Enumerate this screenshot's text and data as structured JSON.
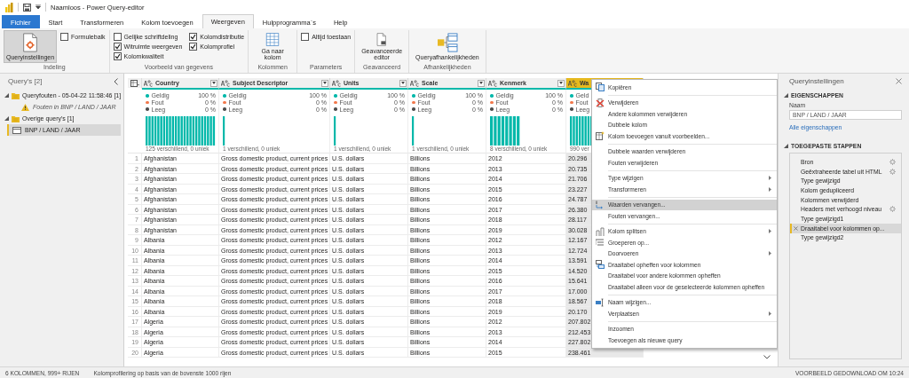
{
  "window": {
    "title": "Naamloos - Power Query-editor"
  },
  "ribbon_tabs": [
    {
      "label": "Fichier",
      "kind": "file",
      "selected": false
    },
    {
      "label": "Start",
      "kind": "tab",
      "selected": false
    },
    {
      "label": "Transformeren",
      "kind": "tab",
      "selected": false
    },
    {
      "label": "Kolom toevoegen",
      "kind": "tab",
      "selected": false
    },
    {
      "label": "Weergeven",
      "kind": "tab",
      "selected": true
    },
    {
      "label": "Hulpprogramma`s",
      "kind": "tab",
      "selected": false
    },
    {
      "label": "Help",
      "kind": "tab",
      "selected": false
    }
  ],
  "ribbon_groups": [
    {
      "label": "Indeling",
      "controls": [
        {
          "kind": "large",
          "label": "Queryinstellingen",
          "selected": true
        },
        {
          "kind": "checkbox",
          "label": "Formulebalk",
          "checked": false
        }
      ]
    },
    {
      "label": "Voorbeeld van gegevens",
      "controls": [
        {
          "kind": "checkbox",
          "label": "Gelijke schriftdeling",
          "checked": false
        },
        {
          "kind": "checkbox",
          "label": "Witruimte weergeven",
          "checked": true
        },
        {
          "kind": "checkbox",
          "label": "Kolomkwaliteit",
          "checked": true
        },
        {
          "kind": "checkbox",
          "label": "Kolomdistributie",
          "checked": true
        },
        {
          "kind": "checkbox",
          "label": "Kolomprofiel",
          "checked": true
        }
      ]
    },
    {
      "label": "Kolommen",
      "controls": [
        {
          "kind": "large",
          "label": "Ga naar kolom",
          "selected": false
        }
      ]
    },
    {
      "label": "Parameters",
      "controls": [
        {
          "kind": "checkbox",
          "label": "Altijd toestaan",
          "checked": false
        }
      ]
    },
    {
      "label": "Geavanceerd",
      "controls": [
        {
          "kind": "large",
          "label": "Geavanceerde editor",
          "selected": false
        }
      ]
    },
    {
      "label": "Afhankelijkheden",
      "controls": [
        {
          "kind": "large",
          "label": "Queryafhankelijkheden",
          "selected": false
        }
      ]
    }
  ],
  "query_pane": {
    "title": "Query's [2]",
    "groups": [
      {
        "label": "Queryfouten - 05-04-22 11:58:46 [1]",
        "expanded": true,
        "children": [
          {
            "label": "Fouten in BNP / LAND / JAAR",
            "kind": "error",
            "selected": false
          }
        ]
      },
      {
        "label": "Overige query's [1]",
        "expanded": true,
        "children": [
          {
            "label": "BNP / LAND / JAAR",
            "kind": "table",
            "selected": true
          }
        ]
      }
    ]
  },
  "grid": {
    "columns": [
      {
        "name": "Country",
        "selected": false,
        "kind": "many",
        "distinct": "125 verschillend, 0 uniek",
        "legend": [
          {
            "label": "Geldig",
            "value": "100 %",
            "color": "#01b8aa"
          },
          {
            "label": "Fout",
            "value": "0 %",
            "color": "#f2784b"
          },
          {
            "label": "Leeg",
            "value": "0 %",
            "color": "#4d4d4d"
          }
        ]
      },
      {
        "name": "Subject Descriptor",
        "selected": false,
        "kind": "single",
        "distinct": "1 verschillend, 0 uniek",
        "legend": [
          {
            "label": "Geldig",
            "value": "100 %",
            "color": "#01b8aa"
          },
          {
            "label": "Fout",
            "value": "0 %",
            "color": "#f2784b"
          },
          {
            "label": "Leeg",
            "value": "0 %",
            "color": "#4d4d4d"
          }
        ]
      },
      {
        "name": "Units",
        "selected": false,
        "kind": "single",
        "distinct": "1 verschillend, 0 uniek",
        "legend": [
          {
            "label": "Geldig",
            "value": "100 %",
            "color": "#01b8aa"
          },
          {
            "label": "Fout",
            "value": "0 %",
            "color": "#f2784b"
          },
          {
            "label": "Leeg",
            "value": "0 %",
            "color": "#4d4d4d"
          }
        ]
      },
      {
        "name": "Scale",
        "selected": false,
        "kind": "single",
        "distinct": "1 verschillend, 0 uniek",
        "legend": [
          {
            "label": "Geldig",
            "value": "100 %",
            "color": "#01b8aa"
          },
          {
            "label": "Fout",
            "value": "0 %",
            "color": "#f2784b"
          },
          {
            "label": "Leeg",
            "value": "0 %",
            "color": "#4d4d4d"
          }
        ]
      },
      {
        "name": "Kenmerk",
        "selected": false,
        "kind": "few",
        "distinct": "8 verschillend, 0 uniek",
        "legend": [
          {
            "label": "Geldig",
            "value": "100 %",
            "color": "#01b8aa"
          },
          {
            "label": "Fout",
            "value": "0 %",
            "color": "#f2784b"
          },
          {
            "label": "Leeg",
            "value": "0 %",
            "color": "#4d4d4d"
          }
        ]
      },
      {
        "name": "Wa",
        "selected": true,
        "kind": "many",
        "distinct": "990 ver",
        "legend": [
          {
            "label": "Geld",
            "color": "#01b8aa"
          },
          {
            "label": "Fout",
            "color": "#f2784b"
          },
          {
            "label": "Leeg",
            "color": "#4d4d4d"
          }
        ]
      }
    ],
    "rows": [
      {
        "number": "1",
        "cells": [
          "Afghanistan",
          "Gross domestic product, current prices",
          "U.S. dollars",
          "Billions",
          "2012",
          "20.296"
        ]
      },
      {
        "number": "2",
        "cells": [
          "Afghanistan",
          "Gross domestic product, current prices",
          "U.S. dollars",
          "Billions",
          "2013",
          "20.735"
        ]
      },
      {
        "number": "3",
        "cells": [
          "Afghanistan",
          "Gross domestic product, current prices",
          "U.S. dollars",
          "Billions",
          "2014",
          "21.706"
        ]
      },
      {
        "number": "4",
        "cells": [
          "Afghanistan",
          "Gross domestic product, current prices",
          "U.S. dollars",
          "Billions",
          "2015",
          "23.227"
        ]
      },
      {
        "number": "5",
        "cells": [
          "Afghanistan",
          "Gross domestic product, current prices",
          "U.S. dollars",
          "Billions",
          "2016",
          "24.787"
        ]
      },
      {
        "number": "6",
        "cells": [
          "Afghanistan",
          "Gross domestic product, current prices",
          "U.S. dollars",
          "Billions",
          "2017",
          "26.380"
        ]
      },
      {
        "number": "7",
        "cells": [
          "Afghanistan",
          "Gross domestic product, current prices",
          "U.S. dollars",
          "Billions",
          "2018",
          "28.117"
        ]
      },
      {
        "number": "8",
        "cells": [
          "Afghanistan",
          "Gross domestic product, current prices",
          "U.S. dollars",
          "Billions",
          "2019",
          "30.028"
        ]
      },
      {
        "number": "9",
        "cells": [
          "Albania",
          "Gross domestic product, current prices",
          "U.S. dollars",
          "Billions",
          "2012",
          "12.167"
        ]
      },
      {
        "number": "10",
        "cells": [
          "Albania",
          "Gross domestic product, current prices",
          "U.S. dollars",
          "Billions",
          "2013",
          "12.724"
        ]
      },
      {
        "number": "11",
        "cells": [
          "Albania",
          "Gross domestic product, current prices",
          "U.S. dollars",
          "Billions",
          "2014",
          "13.591"
        ]
      },
      {
        "number": "12",
        "cells": [
          "Albania",
          "Gross domestic product, current prices",
          "U.S. dollars",
          "Billions",
          "2015",
          "14.520"
        ]
      },
      {
        "number": "13",
        "cells": [
          "Albania",
          "Gross domestic product, current prices",
          "U.S. dollars",
          "Billions",
          "2016",
          "15.641"
        ]
      },
      {
        "number": "14",
        "cells": [
          "Albania",
          "Gross domestic product, current prices",
          "U.S. dollars",
          "Billions",
          "2017",
          "17.000"
        ]
      },
      {
        "number": "15",
        "cells": [
          "Albania",
          "Gross domestic product, current prices",
          "U.S. dollars",
          "Billions",
          "2018",
          "18.567"
        ]
      },
      {
        "number": "16",
        "cells": [
          "Albania",
          "Gross domestic product, current prices",
          "U.S. dollars",
          "Billions",
          "2019",
          "20.170"
        ]
      },
      {
        "number": "17",
        "cells": [
          "Algeria",
          "Gross domestic product, current prices",
          "U.S. dollars",
          "Billions",
          "2012",
          "207.802"
        ]
      },
      {
        "number": "18",
        "cells": [
          "Algeria",
          "Gross domestic product, current prices",
          "U.S. dollars",
          "Billions",
          "2013",
          "212.453"
        ]
      },
      {
        "number": "19",
        "cells": [
          "Algeria",
          "Gross domestic product, current prices",
          "U.S. dollars",
          "Billions",
          "2014",
          "227.802"
        ]
      },
      {
        "number": "20",
        "cells": [
          "Algeria",
          "Gross domestic product, current prices",
          "U.S. dollars",
          "Billions",
          "2015",
          "238.461"
        ]
      }
    ]
  },
  "context_menu": {
    "items": [
      {
        "kind": "copy",
        "label": "Kopiëren",
        "submenu": false,
        "selected": false
      },
      {
        "kind": "separator"
      },
      {
        "kind": "remove",
        "label": "Verwijderen",
        "submenu": false,
        "selected": false
      },
      {
        "kind": "plain",
        "label": "Andere kolommen verwijderen",
        "submenu": false,
        "selected": false
      },
      {
        "kind": "plain",
        "label": "Dubbele kolom",
        "submenu": false,
        "selected": false
      },
      {
        "kind": "examples",
        "label": "Kolom toevoegen vanuit voorbeelden...",
        "submenu": false,
        "selected": false
      },
      {
        "kind": "separator"
      },
      {
        "kind": "plain",
        "label": "Dubbele waarden verwijderen",
        "submenu": false,
        "selected": false
      },
      {
        "kind": "plain",
        "label": "Fouten verwijderen",
        "submenu": false,
        "selected": false
      },
      {
        "kind": "separator"
      },
      {
        "kind": "plain",
        "label": "Type wijzigen",
        "submenu": true,
        "selected": false
      },
      {
        "kind": "plain",
        "label": "Transformeren",
        "submenu": true,
        "selected": false
      },
      {
        "kind": "separator"
      },
      {
        "kind": "replace",
        "label": "Waarden vervangen...",
        "submenu": false,
        "selected": true
      },
      {
        "kind": "plain",
        "label": "Fouten vervangen...",
        "submenu": false,
        "selected": false
      },
      {
        "kind": "separator"
      },
      {
        "kind": "split",
        "label": "Kolom splitsen",
        "submenu": true,
        "selected": false
      },
      {
        "kind": "group",
        "label": "Groeperen op...",
        "submenu": false,
        "selected": false
      },
      {
        "kind": "plain",
        "label": "Doorvoeren",
        "submenu": true,
        "selected": false
      },
      {
        "kind": "unpivot",
        "label": "Draaitabel opheffen voor kolommen",
        "submenu": false,
        "selected": false
      },
      {
        "kind": "plain",
        "label": "Draaitabel voor andere kolommen opheffen",
        "submenu": false,
        "selected": false
      },
      {
        "kind": "plain",
        "label": "Draaitabel alleen voor de geselecteerde kolommen opheffen",
        "submenu": false,
        "selected": false
      },
      {
        "kind": "separator"
      },
      {
        "kind": "rename",
        "label": "Naam wijzigen...",
        "submenu": false,
        "selected": false
      },
      {
        "kind": "plain",
        "label": "Verplaatsen",
        "submenu": true,
        "selected": false
      },
      {
        "kind": "separator"
      },
      {
        "kind": "plain",
        "label": "Inzoomen",
        "submenu": false,
        "selected": false
      },
      {
        "kind": "plain",
        "label": "Toevoegen als nieuwe query",
        "submenu": false,
        "selected": false
      }
    ]
  },
  "settings": {
    "title": "Queryinstellingen",
    "sections": [
      {
        "heading": "EIGENSCHAPPEN",
        "expanded": true
      },
      {
        "heading": "TOEGEPASTE STAPPEN",
        "expanded": true
      }
    ],
    "name_label": "Naam",
    "name_value": "BNP / LAND / JAAR",
    "all_properties_link": "Alle eigenschappen",
    "steps": [
      {
        "label": "Bron",
        "settings": true,
        "selected": false
      },
      {
        "label": "Geëxtraheerde tabel uit HTML",
        "settings": true,
        "selected": false
      },
      {
        "label": "Type gewijzigd",
        "settings": false,
        "selected": false
      },
      {
        "label": "Kolom gedupliceerd",
        "settings": false,
        "selected": false
      },
      {
        "label": "Kolommen verwijderd",
        "settings": false,
        "selected": false
      },
      {
        "label": "Headers met verhoogd niveau",
        "settings": true,
        "selected": false
      },
      {
        "label": "Type gewijzigd1",
        "settings": false,
        "selected": false
      },
      {
        "label": "Draaitabel voor kolommen op...",
        "settings": false,
        "selected": true
      },
      {
        "label": "Type gewijzigd2",
        "settings": false,
        "selected": false
      }
    ]
  },
  "status_bar": {
    "left": [
      "6 KOLOMMEN, 999+ RIJEN",
      "Kolomprofilering op basis van de bovenste 1000 rijen"
    ],
    "right": "VOORBEELD GEDOWNLOAD OM 10:24"
  }
}
